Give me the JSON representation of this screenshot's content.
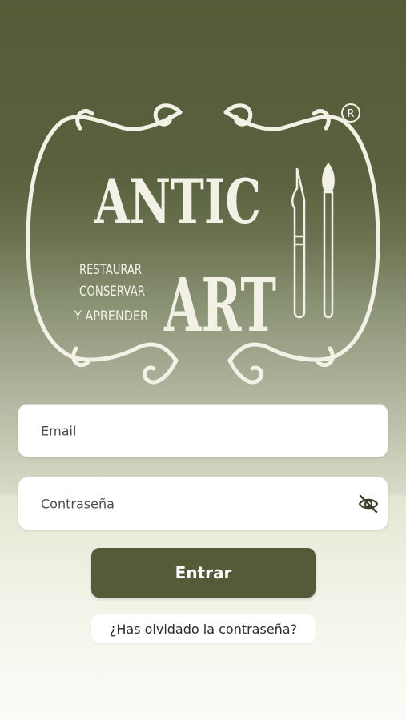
{
  "logo": {
    "word1": "ANTIC",
    "word2": "ART",
    "tagline_1": "RESTAURAR",
    "tagline_2": "CONSERVAR",
    "tagline_3": "Y APRENDER",
    "registered_mark": "R"
  },
  "form": {
    "email_placeholder": "Email",
    "password_placeholder": "Contraseña",
    "submit_label": "Entrar",
    "forgot_label": "¿Has olvidado la contraseña?"
  },
  "colors": {
    "brand_olive": "#535b38",
    "logo_cream": "#f3f1e6",
    "field_bg": "#ffffff",
    "background_light": "#f8f8f1"
  },
  "icons": {
    "password_toggle": "eye-slash-icon"
  }
}
